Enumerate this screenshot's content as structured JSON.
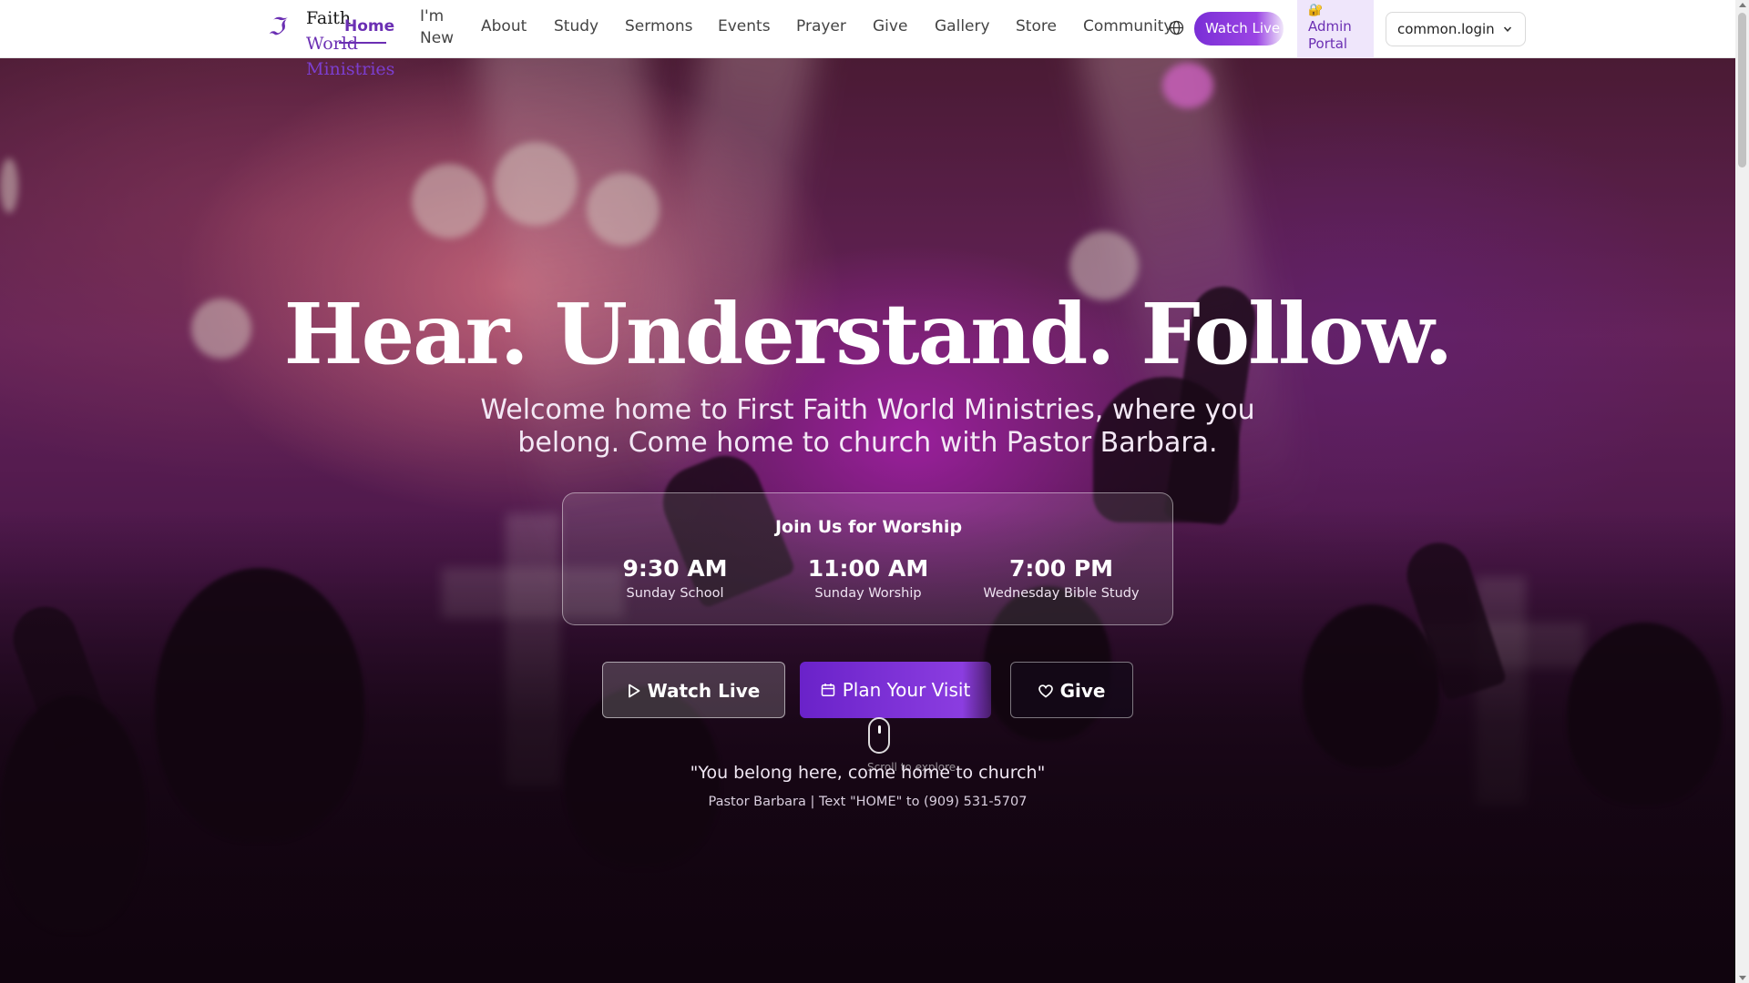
{
  "brand": {
    "line1": "Faith",
    "line2": "World",
    "line3": "Ministries",
    "logo_icon": "cross-script-icon",
    "accent": "#6b2fb3"
  },
  "nav": {
    "items": [
      "Home",
      "I'm",
      "New",
      "About",
      "Study",
      "Sermons",
      "Events",
      "Prayer",
      "Give",
      "Gallery",
      "Store",
      "Community"
    ],
    "active": "Home",
    "watch_live": "Watch Live",
    "admin_icon": "🔐",
    "admin_line1": "Admin",
    "admin_line2": "Portal",
    "login_value": "common.login"
  },
  "hero": {
    "headline": "Hear. Understand. Follow.",
    "subtitle": "Welcome home to First Faith World Ministries, where you belong. Come home to church with Pastor Barbara.",
    "worship": {
      "title": "Join Us for Worship",
      "services": [
        {
          "time": "9:30 AM",
          "label": "Sunday School"
        },
        {
          "time": "11:00 AM",
          "label": "Sunday Worship"
        },
        {
          "time": "7:00 PM",
          "label": "Wednesday Bible Study"
        }
      ]
    },
    "cta": {
      "watch": "Watch Live",
      "plan": "Plan Your Visit",
      "give": "Give"
    },
    "scroll_hint": "Scroll to explore",
    "quote": "\"You belong here, come home to church\"",
    "pastor_line": "Pastor Barbara | Text \"HOME\" to (909) 531-5707"
  }
}
